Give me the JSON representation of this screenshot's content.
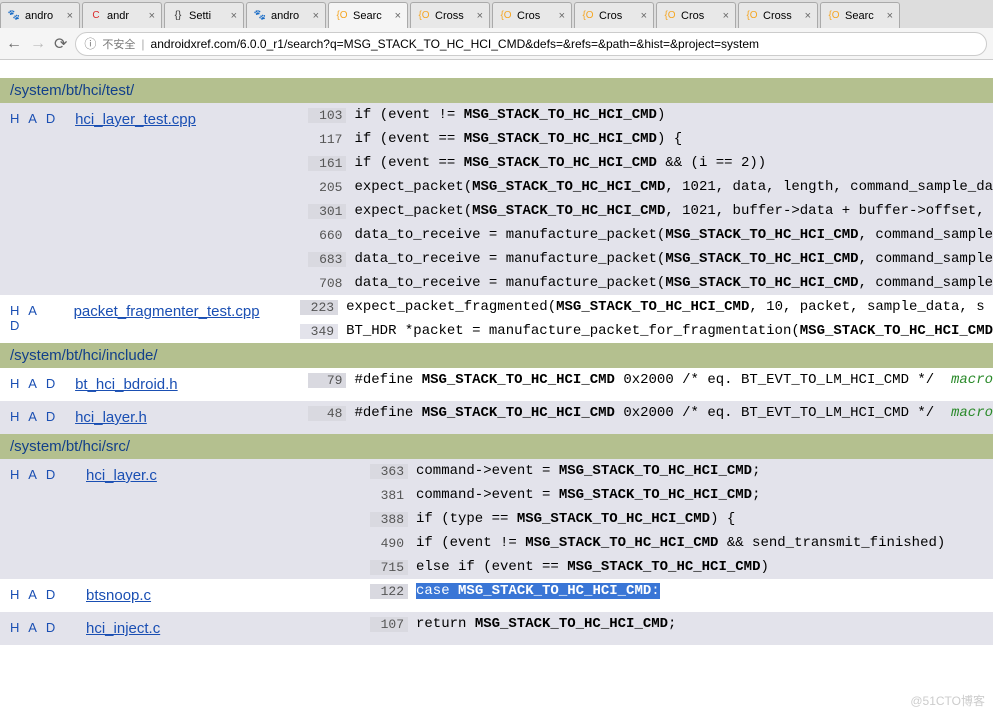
{
  "browser": {
    "tabs": [
      {
        "favicon": "🐾",
        "label": "andro",
        "fav_color": "#2b6fdb"
      },
      {
        "favicon": "C",
        "label": "andr",
        "fav_color": "#db2b2b"
      },
      {
        "favicon": "{}",
        "label": "Setti",
        "fav_color": "#333"
      },
      {
        "favicon": "🐾",
        "label": "andro",
        "fav_color": "#2b6fdb"
      },
      {
        "favicon": "{O",
        "label": "Searc",
        "fav_color": "#f5a623",
        "active": true
      },
      {
        "favicon": "{O",
        "label": "Cross",
        "fav_color": "#f5a623"
      },
      {
        "favicon": "{O",
        "label": "Cros",
        "fav_color": "#f5a623"
      },
      {
        "favicon": "{O",
        "label": "Cros",
        "fav_color": "#f5a623"
      },
      {
        "favicon": "{O",
        "label": "Cros",
        "fav_color": "#f5a623"
      },
      {
        "favicon": "{O",
        "label": "Cross",
        "fav_color": "#f5a623"
      },
      {
        "favicon": "{O",
        "label": "Searc",
        "fav_color": "#f5a623"
      }
    ],
    "insecure_label": "不安全",
    "url": "androidxref.com/6.0.0_r1/search?q=MSG_STACK_TO_HC_HCI_CMD&defs=&refs=&path=&hist=&project=system"
  },
  "search_term": "MSG_STACK_TO_HC_HCI_CMD",
  "had_label": "H A D",
  "macro_label": "macro",
  "sections": [
    {
      "path": "/system/bt/hci/test/",
      "files": [
        {
          "name": "hci_layer_test.cpp",
          "alt": true,
          "lines": [
            {
              "n": "103",
              "pre": "if (event != ",
              "post": ")"
            },
            {
              "n": "117",
              "pre": "if (event == ",
              "post": ") {"
            },
            {
              "n": "161",
              "pre": "if (event == ",
              "post": " && (i == 2))"
            },
            {
              "n": "205",
              "pre": "expect_packet(",
              "post": ", 1021, data, length, command_sample_da"
            },
            {
              "n": "301",
              "pre": "expect_packet(",
              "post": ", 1021, buffer->data + buffer->offset, "
            },
            {
              "n": "660",
              "pre": "data_to_receive = manufacture_packet(",
              "post": ", command_sample"
            },
            {
              "n": "683",
              "pre": "data_to_receive = manufacture_packet(",
              "post": ", command_sample"
            },
            {
              "n": "708",
              "pre": "data_to_receive = manufacture_packet(",
              "post": ", command_sample"
            }
          ]
        },
        {
          "name": "packet_fragmenter_test.cpp",
          "alt": false,
          "lines": [
            {
              "n": "223",
              "pre": "expect_packet_fragmented(",
              "post": ", 10, packet, sample_data, s"
            },
            {
              "n": "349",
              "pre": "BT_HDR *packet = manufacture_packet_for_fragmentation(",
              "post": ""
            }
          ]
        }
      ]
    },
    {
      "path": "/system/bt/hci/include/",
      "files": [
        {
          "name": "bt_hci_bdroid.h",
          "alt": false,
          "lines": [
            {
              "n": "79",
              "pre": "#define ",
              "post": " 0x2000 /* eq. BT_EVT_TO_LM_HCI_CMD */  ",
              "macro": true
            }
          ]
        },
        {
          "name": "hci_layer.h",
          "alt": true,
          "lines": [
            {
              "n": "48",
              "pre": "#define ",
              "post": " 0x2000 /* eq. BT_EVT_TO_LM_HCI_CMD */  ",
              "macro": true
            }
          ]
        }
      ]
    },
    {
      "path": "/system/bt/hci/src/",
      "files": [
        {
          "name": "hci_layer.c",
          "alt": true,
          "lines": [
            {
              "n": "363",
              "pre": "command->event = ",
              "post": ";"
            },
            {
              "n": "381",
              "pre": "command->event = ",
              "post": ";"
            },
            {
              "n": "388",
              "pre": "if (type == ",
              "post": ") {"
            },
            {
              "n": "490",
              "pre": "if (event != ",
              "post": " && send_transmit_finished)"
            },
            {
              "n": "715",
              "pre": "else if (event == ",
              "post": ")"
            }
          ]
        },
        {
          "name": "btsnoop.c",
          "alt": false,
          "lines": [
            {
              "n": "122",
              "pre": "",
              "post": "",
              "selected": true,
              "sel_pre": "case ",
              "sel_post": ":"
            }
          ]
        },
        {
          "name": "hci_inject.c",
          "alt": true,
          "lines": [
            {
              "n": "107",
              "pre": "return ",
              "post": ";"
            }
          ]
        }
      ]
    }
  ],
  "watermark": "@51CTO博客"
}
